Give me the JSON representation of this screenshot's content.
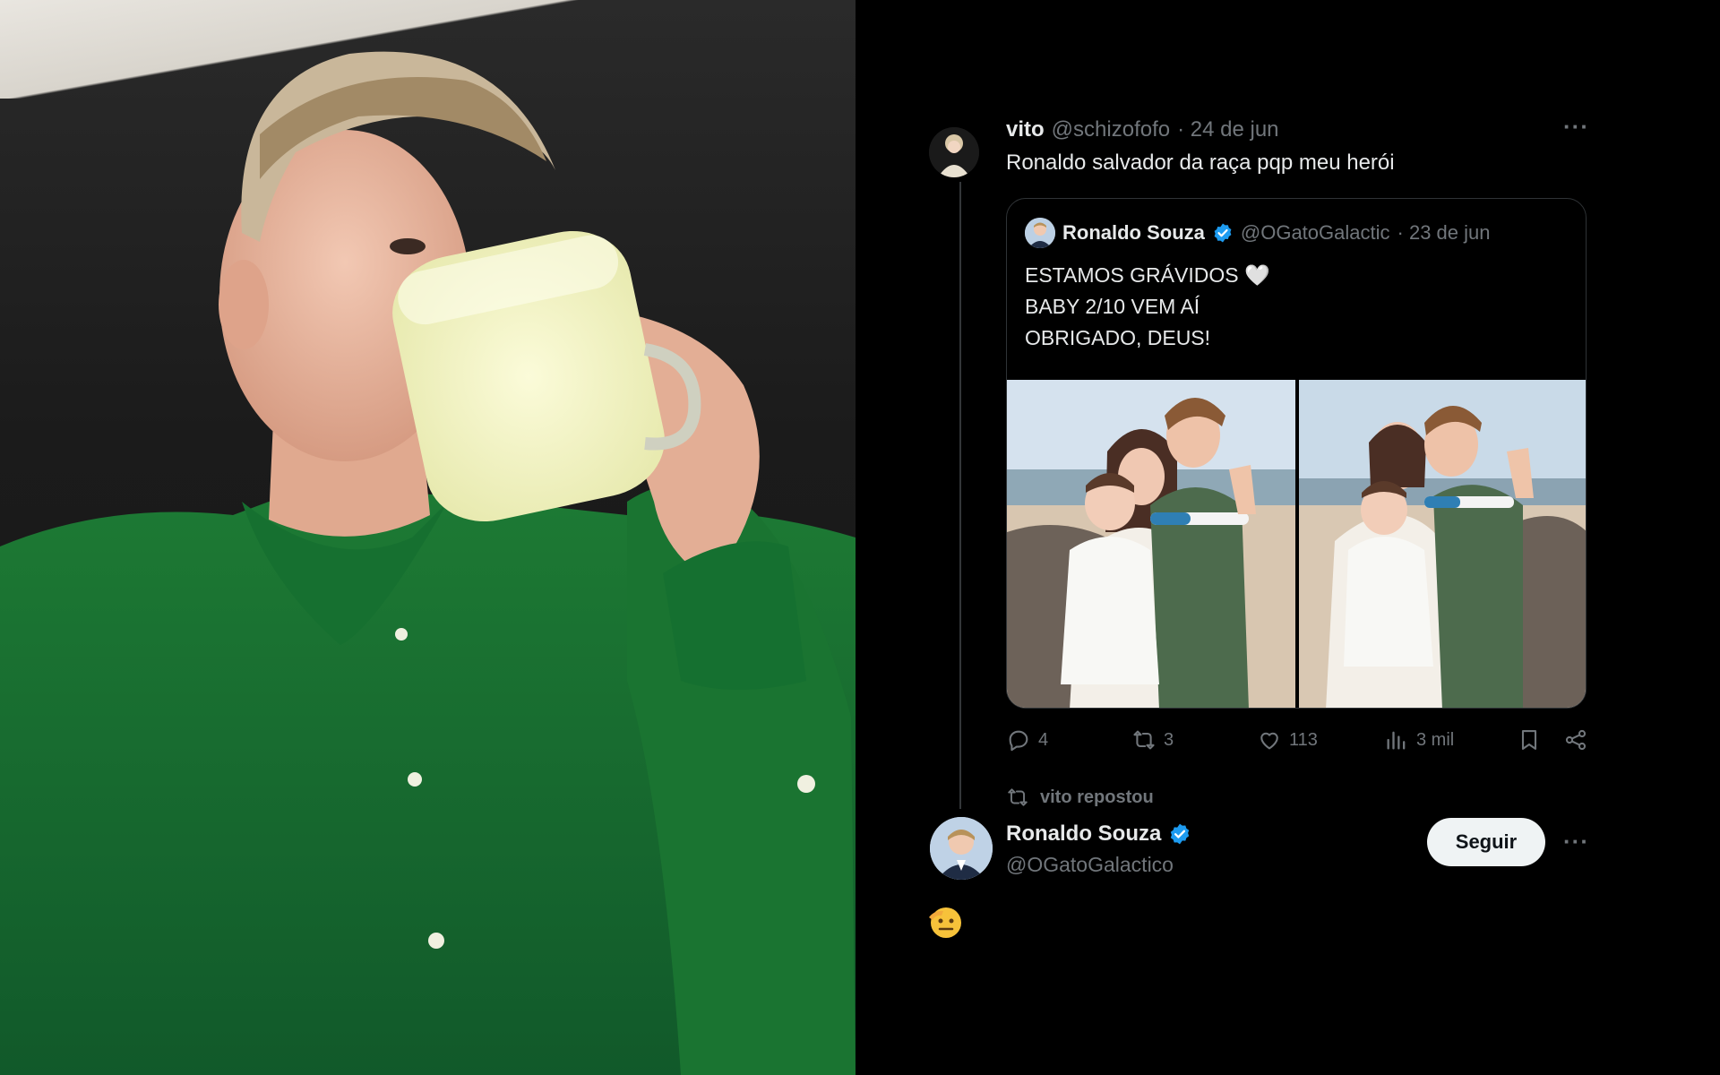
{
  "tweet": {
    "author_name": "vito",
    "author_handle": "@schizofofo",
    "date": "· 24 de jun",
    "more_icon": "ellipsis-icon",
    "text": "Ronaldo salvador da raça pqp meu herói"
  },
  "quote": {
    "author_name": "Ronaldo Souza",
    "author_handle": "@OGatoGalactic",
    "date": "· 23 de jun",
    "verified_icon": "verified-badge-icon",
    "text": "ESTAMOS GRÁVIDOS 🤍\nBABY 2/10 VEM AÍ\nOBRIGADO, DEUS!",
    "images": [
      "photo-family-left",
      "photo-family-right"
    ]
  },
  "actions": {
    "replies": "4",
    "reposts": "3",
    "likes": "113",
    "views": "3 mil",
    "icons": [
      "reply-icon",
      "repost-icon",
      "like-icon",
      "views-icon",
      "bookmark-icon",
      "share-icon"
    ]
  },
  "repost_notice": {
    "icon": "repost-icon",
    "text": "vito repostou"
  },
  "profile": {
    "name": "Ronaldo Souza",
    "handle": "@OGatoGalactico",
    "follow_label": "Seguir",
    "more_icon": "ellipsis-icon"
  },
  "reply_emoji": "saluting-face-emoji",
  "colors": {
    "background": "#000000",
    "text": "#e7e9ea",
    "muted": "#71767b",
    "verified": "#1d9bf0",
    "border": "#2f3336",
    "shirt_green": "#176b2b"
  }
}
